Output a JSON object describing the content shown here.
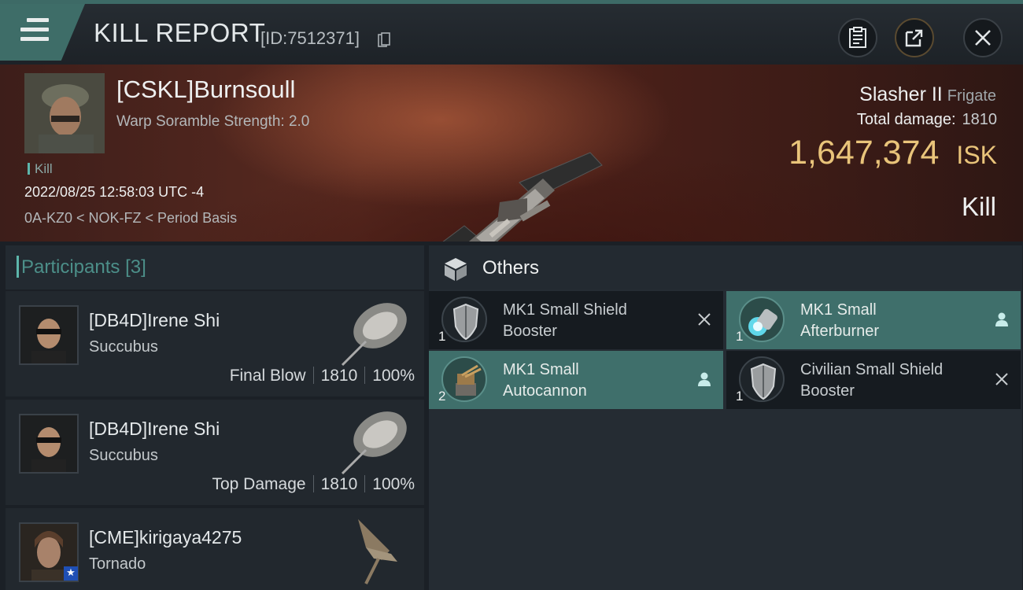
{
  "header": {
    "title": "KILL REPORT",
    "report_id": "[ID:7512371]",
    "menu_icon": "hamburger-menu-icon",
    "buttons": [
      "clipboard-icon",
      "share-export-icon",
      "close-icon"
    ]
  },
  "victim": {
    "name": "[CSKL]Burnsoull",
    "warp_scramble": "Warp Soramble Strength: 2.0",
    "tag": "Kill",
    "timestamp": "2022/08/25 12:58:03 UTC -4",
    "location": "0A-KZ0 < NOK-FZ < Period Basis",
    "ship": "Slasher II",
    "ship_class": "Frigate",
    "total_damage_label": "Total damage:",
    "total_damage": "1810",
    "isk_value": "1,647,374",
    "isk_unit": "ISK",
    "result": "Kill"
  },
  "participants": {
    "label": "Participants",
    "count": "[3]",
    "rows": [
      {
        "name": "[DB4D]Irene Shi",
        "ship": "Succubus",
        "stat_label": "Final Blow",
        "damage": "1810",
        "percent": "100%"
      },
      {
        "name": "[DB4D]Irene Shi",
        "ship": "Succubus",
        "stat_label": "Top Damage",
        "damage": "1810",
        "percent": "100%"
      },
      {
        "name": "[CME]kirigaya4275",
        "ship": "Tornado"
      }
    ]
  },
  "others": {
    "label": "Others",
    "items": [
      {
        "name_line1": "MK1 Small Shield",
        "name_line2": "Booster",
        "qty": "1",
        "state": "destroyed",
        "icon": "shield-booster-icon",
        "action_icon": "x-icon"
      },
      {
        "name_line1": "MK1 Small",
        "name_line2": "Afterburner",
        "qty": "1",
        "state": "dropped",
        "icon": "afterburner-icon",
        "action_icon": "person-icon"
      },
      {
        "name_line1": "MK1 Small",
        "name_line2": "Autocannon",
        "qty": "2",
        "state": "dropped",
        "icon": "autocannon-icon",
        "action_icon": "person-icon"
      },
      {
        "name_line1": "Civilian Small Shield",
        "name_line2": "Booster",
        "qty": "1",
        "state": "destroyed",
        "icon": "shield-booster-icon",
        "action_icon": "x-icon"
      }
    ]
  },
  "colors": {
    "accent_teal": "#3f6f6b",
    "isk_gold": "#e9c47a",
    "panel_dark": "#161b20"
  }
}
